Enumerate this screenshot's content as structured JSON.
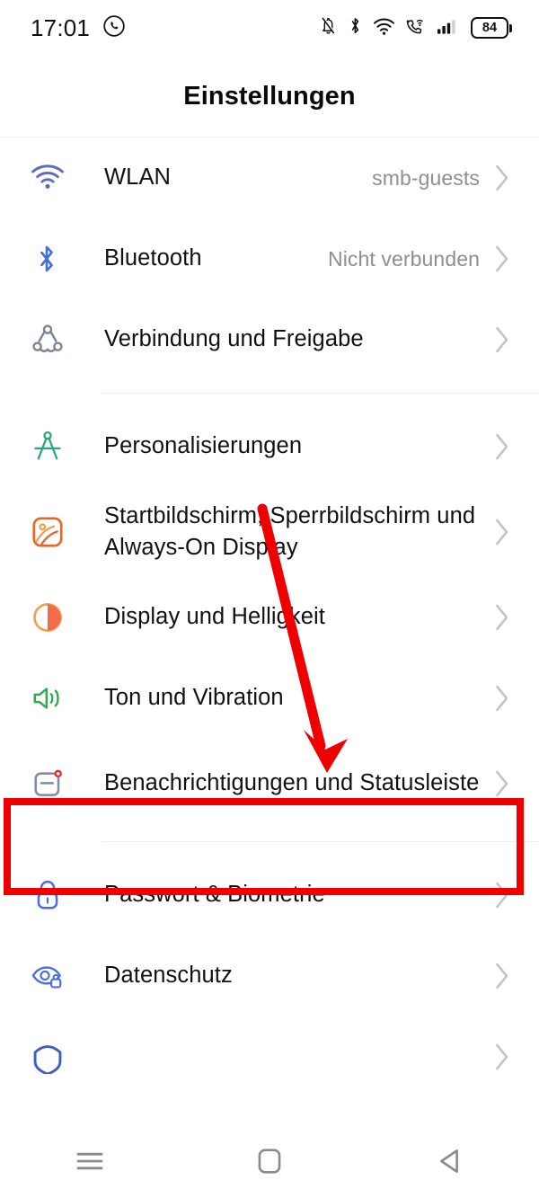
{
  "statusbar": {
    "time": "17:01",
    "left_icons": [
      {
        "name": "whatsapp-icon"
      }
    ],
    "right_icons": [
      {
        "name": "mute-bell-icon"
      },
      {
        "name": "bluetooth-icon"
      },
      {
        "name": "wifi-icon"
      },
      {
        "name": "wifi-calling-icon"
      },
      {
        "name": "cellular-signal-icon"
      }
    ],
    "battery_level": "84"
  },
  "header": {
    "title": "Einstellungen"
  },
  "settings": {
    "groups": [
      {
        "items": [
          {
            "icon": "wifi-icon",
            "label": "WLAN",
            "value": "smb-guests",
            "accent": "#5b69c4"
          },
          {
            "icon": "bluetooth-icon",
            "label": "Bluetooth",
            "value": "Nicht verbunden",
            "accent": "#3f6fd8"
          },
          {
            "icon": "share-nodes-icon",
            "label": "Verbindung und Freigabe",
            "value": "",
            "accent": "#7c8494"
          }
        ]
      },
      {
        "items": [
          {
            "icon": "compass-icon",
            "label": "Personalisierungen",
            "value": "",
            "accent": "#28a87a"
          },
          {
            "icon": "wallpaper-icon",
            "label": "Startbildschirm, Sperrbildschirm und Always-On Display",
            "value": "",
            "accent": "#e8652a"
          },
          {
            "icon": "brightness-icon",
            "label": "Display und Helligkeit",
            "value": "",
            "accent": "#f08a3c"
          },
          {
            "icon": "speaker-icon",
            "label": "Ton und Vibration",
            "value": "",
            "accent": "#2faa57"
          },
          {
            "icon": "notification-card-icon",
            "label": "Benachrichtigungen und Statusleiste",
            "value": "",
            "accent": "#7c8ba8",
            "highlighted": true
          }
        ]
      },
      {
        "items": [
          {
            "icon": "lock-icon",
            "label": "Passwort & Biometrie",
            "value": "",
            "accent": "#4a6ee0"
          },
          {
            "icon": "privacy-eye-icon",
            "label": "Datenschutz",
            "value": "",
            "accent": "#4a6ee0"
          },
          {
            "icon": "shield-icon",
            "label": "",
            "value": "",
            "accent": "#3f5cc4"
          }
        ]
      }
    ]
  },
  "annotation": {
    "highlight_color": "#ee0000",
    "arrow_color": "#ee0000",
    "arrow_from": "Personalisierungen",
    "arrow_to": "Benachrichtigungen und Statusleiste"
  },
  "navbar": {
    "buttons": [
      {
        "name": "recents-button",
        "icon": "menu-icon"
      },
      {
        "name": "home-button",
        "icon": "square-icon"
      },
      {
        "name": "back-button",
        "icon": "triangle-left-icon"
      }
    ]
  }
}
